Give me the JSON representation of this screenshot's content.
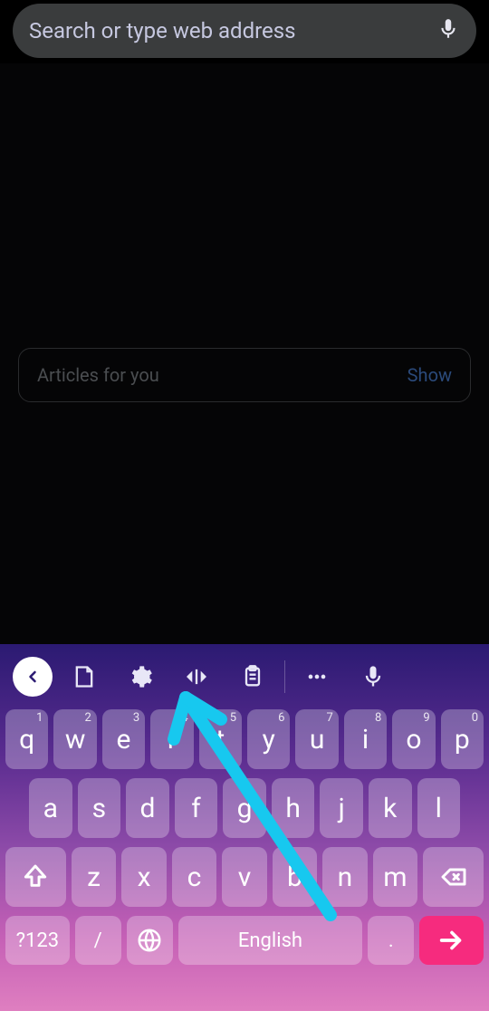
{
  "search": {
    "placeholder": "Search or type web address"
  },
  "articles": {
    "label": "Articles for you",
    "action": "Show"
  },
  "keyboard": {
    "row1": [
      "q",
      "w",
      "e",
      "r",
      "t",
      "y",
      "u",
      "i",
      "o",
      "p"
    ],
    "row1_sup": [
      "1",
      "2",
      "3",
      "4",
      "5",
      "6",
      "7",
      "8",
      "9",
      "0"
    ],
    "row2": [
      "a",
      "s",
      "d",
      "f",
      "g",
      "h",
      "j",
      "k",
      "l"
    ],
    "row3": [
      "z",
      "x",
      "c",
      "v",
      "b",
      "n",
      "m"
    ],
    "symbols_label": "?123",
    "slash_label": "/",
    "space_label": "English",
    "period_label": "."
  }
}
